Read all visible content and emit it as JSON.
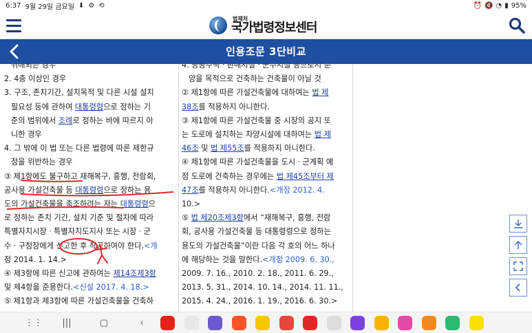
{
  "status_bar": {
    "time": "6:37",
    "date": "9월 29일 금요일",
    "battery": "95%"
  },
  "header": {
    "logo_small": "법제처",
    "logo_big": "국가법령정보센터"
  },
  "titlebar": {
    "title": "인용조문 3단비교"
  },
  "col1": {
    "lines": [
      [
        "위배되는 경우"
      ],
      [
        "2. 4층 이상인 경우"
      ],
      [
        "3. 구조, 존치기간, 설치목적 및 다른 시설 설치"
      ],
      [
        "필요성 등에 관하여 ",
        "대통령령",
        "으로 정하는 기"
      ],
      [
        "준의 범위에서 ",
        "조례",
        "로 정하는 바에 따르지 아"
      ],
      [
        "니한 경우"
      ],
      [
        "4. 그 밖에 이 법 또는 다른 법령에 따른 제한규"
      ],
      [
        "정을 위반하는 경우"
      ],
      [
        "③ 제1항에도 불구하고 재해복구, 흥행, 전람회,"
      ],
      [
        "공사용 가설건축물 등 ",
        "대통령령",
        "으로 정하는 용"
      ],
      [
        "도의 가설건축물을 축조하려는 자는 ",
        "대통령령",
        "으"
      ],
      [
        "로 정하는 존치 기간, 설치 기준 및 절차에 따라"
      ],
      [
        "특별자치시장ㆍ특별자치도지사 또는 시장ㆍ군"
      ],
      [
        "수ㆍ구청장에게 신고한 후 착공하여야 한다.",
        "<개"
      ],
      [
        "정 2014. 1. 14.>"
      ],
      [
        "④ 제3항에 따른 신고에 관하여는 ",
        "제14조제3항"
      ],
      [
        "및 제4항을 준용한다.",
        "<신설 2017. 4. 18.>"
      ],
      [
        "⑤ 제1항과 제3항에 따른 가설건축물을 건축하"
      ]
    ]
  },
  "col2": {
    "lines": [
      [
        "4. 공공주택ㆍ판매시설ㆍ군수시설 등으로서 준"
      ],
      [
        "양을 목적으로 건축하는 건축물이 아닐 것"
      ],
      [
        "② 제1항에 따른 가설건축물에 대하여는 ",
        "법 제"
      ],
      [
        "38조",
        "를 적용하지 아니한다."
      ],
      [
        "③ 제1항에 따른 가설건축물 중 시장의 공지 또"
      ],
      [
        "는 도로에 설치하는 차양시설에 대하여는 ",
        "법 제"
      ],
      [
        "46조",
        " 및 ",
        "법 제55조",
        "를 적용하지 아니한다."
      ],
      [
        "④ 제1항에 따른 가설건축물을 도시ㆍ군계획 예"
      ],
      [
        "정 도로에 건축하는 경우에는 ",
        "법 제45조부터 제"
      ],
      [
        "47조",
        "를 적용하지 아니한다.",
        "<개정 2012. 4."
      ],
      [
        "10.>"
      ],
      [
        "⑤ ",
        "법 제20조제3항",
        "에서 “재해복구, 흥행, 전람"
      ],
      [
        "회, 공사용 가설건축물 등 대통령령으로 정하는"
      ],
      [
        "용도의 가설건축물”이란 다음 각 호의 어느 하나"
      ],
      [
        "에 해당하는 것을 말한다.",
        "<개정 2009. 6. 30.,"
      ],
      [
        "2009. 7. 16., 2010. 2. 18., 2011. 6. 29.,"
      ],
      [
        "2013. 5. 31., 2014. 10. 14., 2014. 11. 11.,"
      ],
      [
        "2015. 4. 24., 2016. 1. 19., 2016. 6. 30.>"
      ]
    ]
  },
  "colors": {
    "brand_blue": "#1f4fa0",
    "link": "#1b3fa6",
    "annotation_red": "#e0262b"
  },
  "nav_apps": [
    "youtube",
    "chrome",
    "samsung-internet",
    "brave",
    "maps",
    "shopping",
    "flipboard",
    "text-app",
    "video-player",
    "folder",
    "blossom",
    "camera-app",
    "messenger",
    "kakaotalk"
  ]
}
